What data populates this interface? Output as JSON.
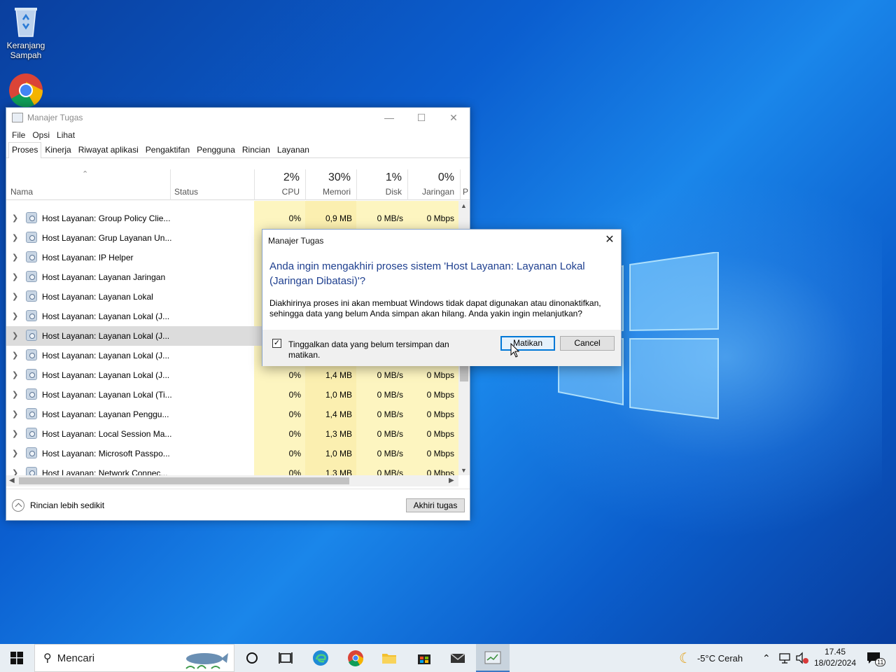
{
  "desktop": {
    "icons": [
      {
        "label": "Keranjang Sampah"
      },
      {
        "label": ""
      }
    ]
  },
  "task_manager": {
    "title": "Manajer Tugas",
    "menu": [
      "File",
      "Opsi",
      "Lihat"
    ],
    "tabs": [
      "Proses",
      "Kinerja",
      "Riwayat aplikasi",
      "Pengaktifan",
      "Pengguna",
      "Rincian",
      "Layanan"
    ],
    "active_tab": "Proses",
    "columns": {
      "name": "Nama",
      "status": "Status",
      "cpu": {
        "pct": "2%",
        "label": "CPU"
      },
      "mem": {
        "pct": "30%",
        "label": "Memori"
      },
      "disk": {
        "pct": "1%",
        "label": "Disk"
      },
      "net": {
        "pct": "0%",
        "label": "Jaringan"
      },
      "extra": "P"
    },
    "rows": [
      {
        "name": "Host Layanan: Group Policy Clie...",
        "cpu": "0%",
        "mem": "0,9 MB",
        "disk": "0 MB/s",
        "net": "0 Mbps"
      },
      {
        "name": "Host Layanan: Grup Layanan Un...",
        "cpu": "",
        "mem": "",
        "disk": "",
        "net": ""
      },
      {
        "name": "Host Layanan: IP Helper",
        "cpu": "",
        "mem": "",
        "disk": "",
        "net": ""
      },
      {
        "name": "Host Layanan: Layanan Jaringan",
        "cpu": "",
        "mem": "",
        "disk": "",
        "net": ""
      },
      {
        "name": "Host Layanan: Layanan Lokal",
        "cpu": "",
        "mem": "",
        "disk": "",
        "net": ""
      },
      {
        "name": "Host Layanan: Layanan Lokal (J...",
        "cpu": "",
        "mem": "",
        "disk": "",
        "net": ""
      },
      {
        "name": "Host Layanan: Layanan Lokal (J...",
        "cpu": "",
        "mem": "",
        "disk": "",
        "net": "",
        "selected": true
      },
      {
        "name": "Host Layanan: Layanan Lokal (J...",
        "cpu": "",
        "mem": "",
        "disk": "",
        "net": ""
      },
      {
        "name": "Host Layanan: Layanan Lokal (J...",
        "cpu": "0%",
        "mem": "1,4 MB",
        "disk": "0 MB/s",
        "net": "0 Mbps"
      },
      {
        "name": "Host Layanan: Layanan Lokal (Ti...",
        "cpu": "0%",
        "mem": "1,0 MB",
        "disk": "0 MB/s",
        "net": "0 Mbps"
      },
      {
        "name": "Host Layanan: Layanan Penggu...",
        "cpu": "0%",
        "mem": "1,4 MB",
        "disk": "0 MB/s",
        "net": "0 Mbps"
      },
      {
        "name": "Host Layanan: Local Session Ma...",
        "cpu": "0%",
        "mem": "1,3 MB",
        "disk": "0 MB/s",
        "net": "0 Mbps"
      },
      {
        "name": "Host Layanan: Microsoft Passpo...",
        "cpu": "0%",
        "mem": "1,0 MB",
        "disk": "0 MB/s",
        "net": "0 Mbps"
      },
      {
        "name": "Host Layanan: Network Connec...",
        "cpu": "0%",
        "mem": "1,3 MB",
        "disk": "0 MB/s",
        "net": "0 Mbps"
      }
    ],
    "footer": {
      "less_details": "Rincian lebih sedikit",
      "end_task": "Akhiri tugas"
    }
  },
  "dialog": {
    "title": "Manajer Tugas",
    "heading": "Anda ingin mengakhiri proses sistem 'Host Layanan: Layanan Lokal (Jaringan Dibatasi)'?",
    "body": "Diakhirinya proses ini akan membuat Windows tidak dapat digunakan atau dinonaktifkan, sehingga data yang belum Anda simpan akan hilang. Anda yakin ingin melanjutkan?",
    "checkbox_label": "Tinggalkan data yang belum tersimpan dan matikan.",
    "checkbox_checked": true,
    "ok_label": "Matikan",
    "cancel_label": "Cancel"
  },
  "taskbar": {
    "search_placeholder": "Mencari",
    "weather": "-5°C  Cerah",
    "time": "17.45",
    "date": "18/02/2024",
    "notification_count": "11",
    "accent": "#0078d7"
  }
}
